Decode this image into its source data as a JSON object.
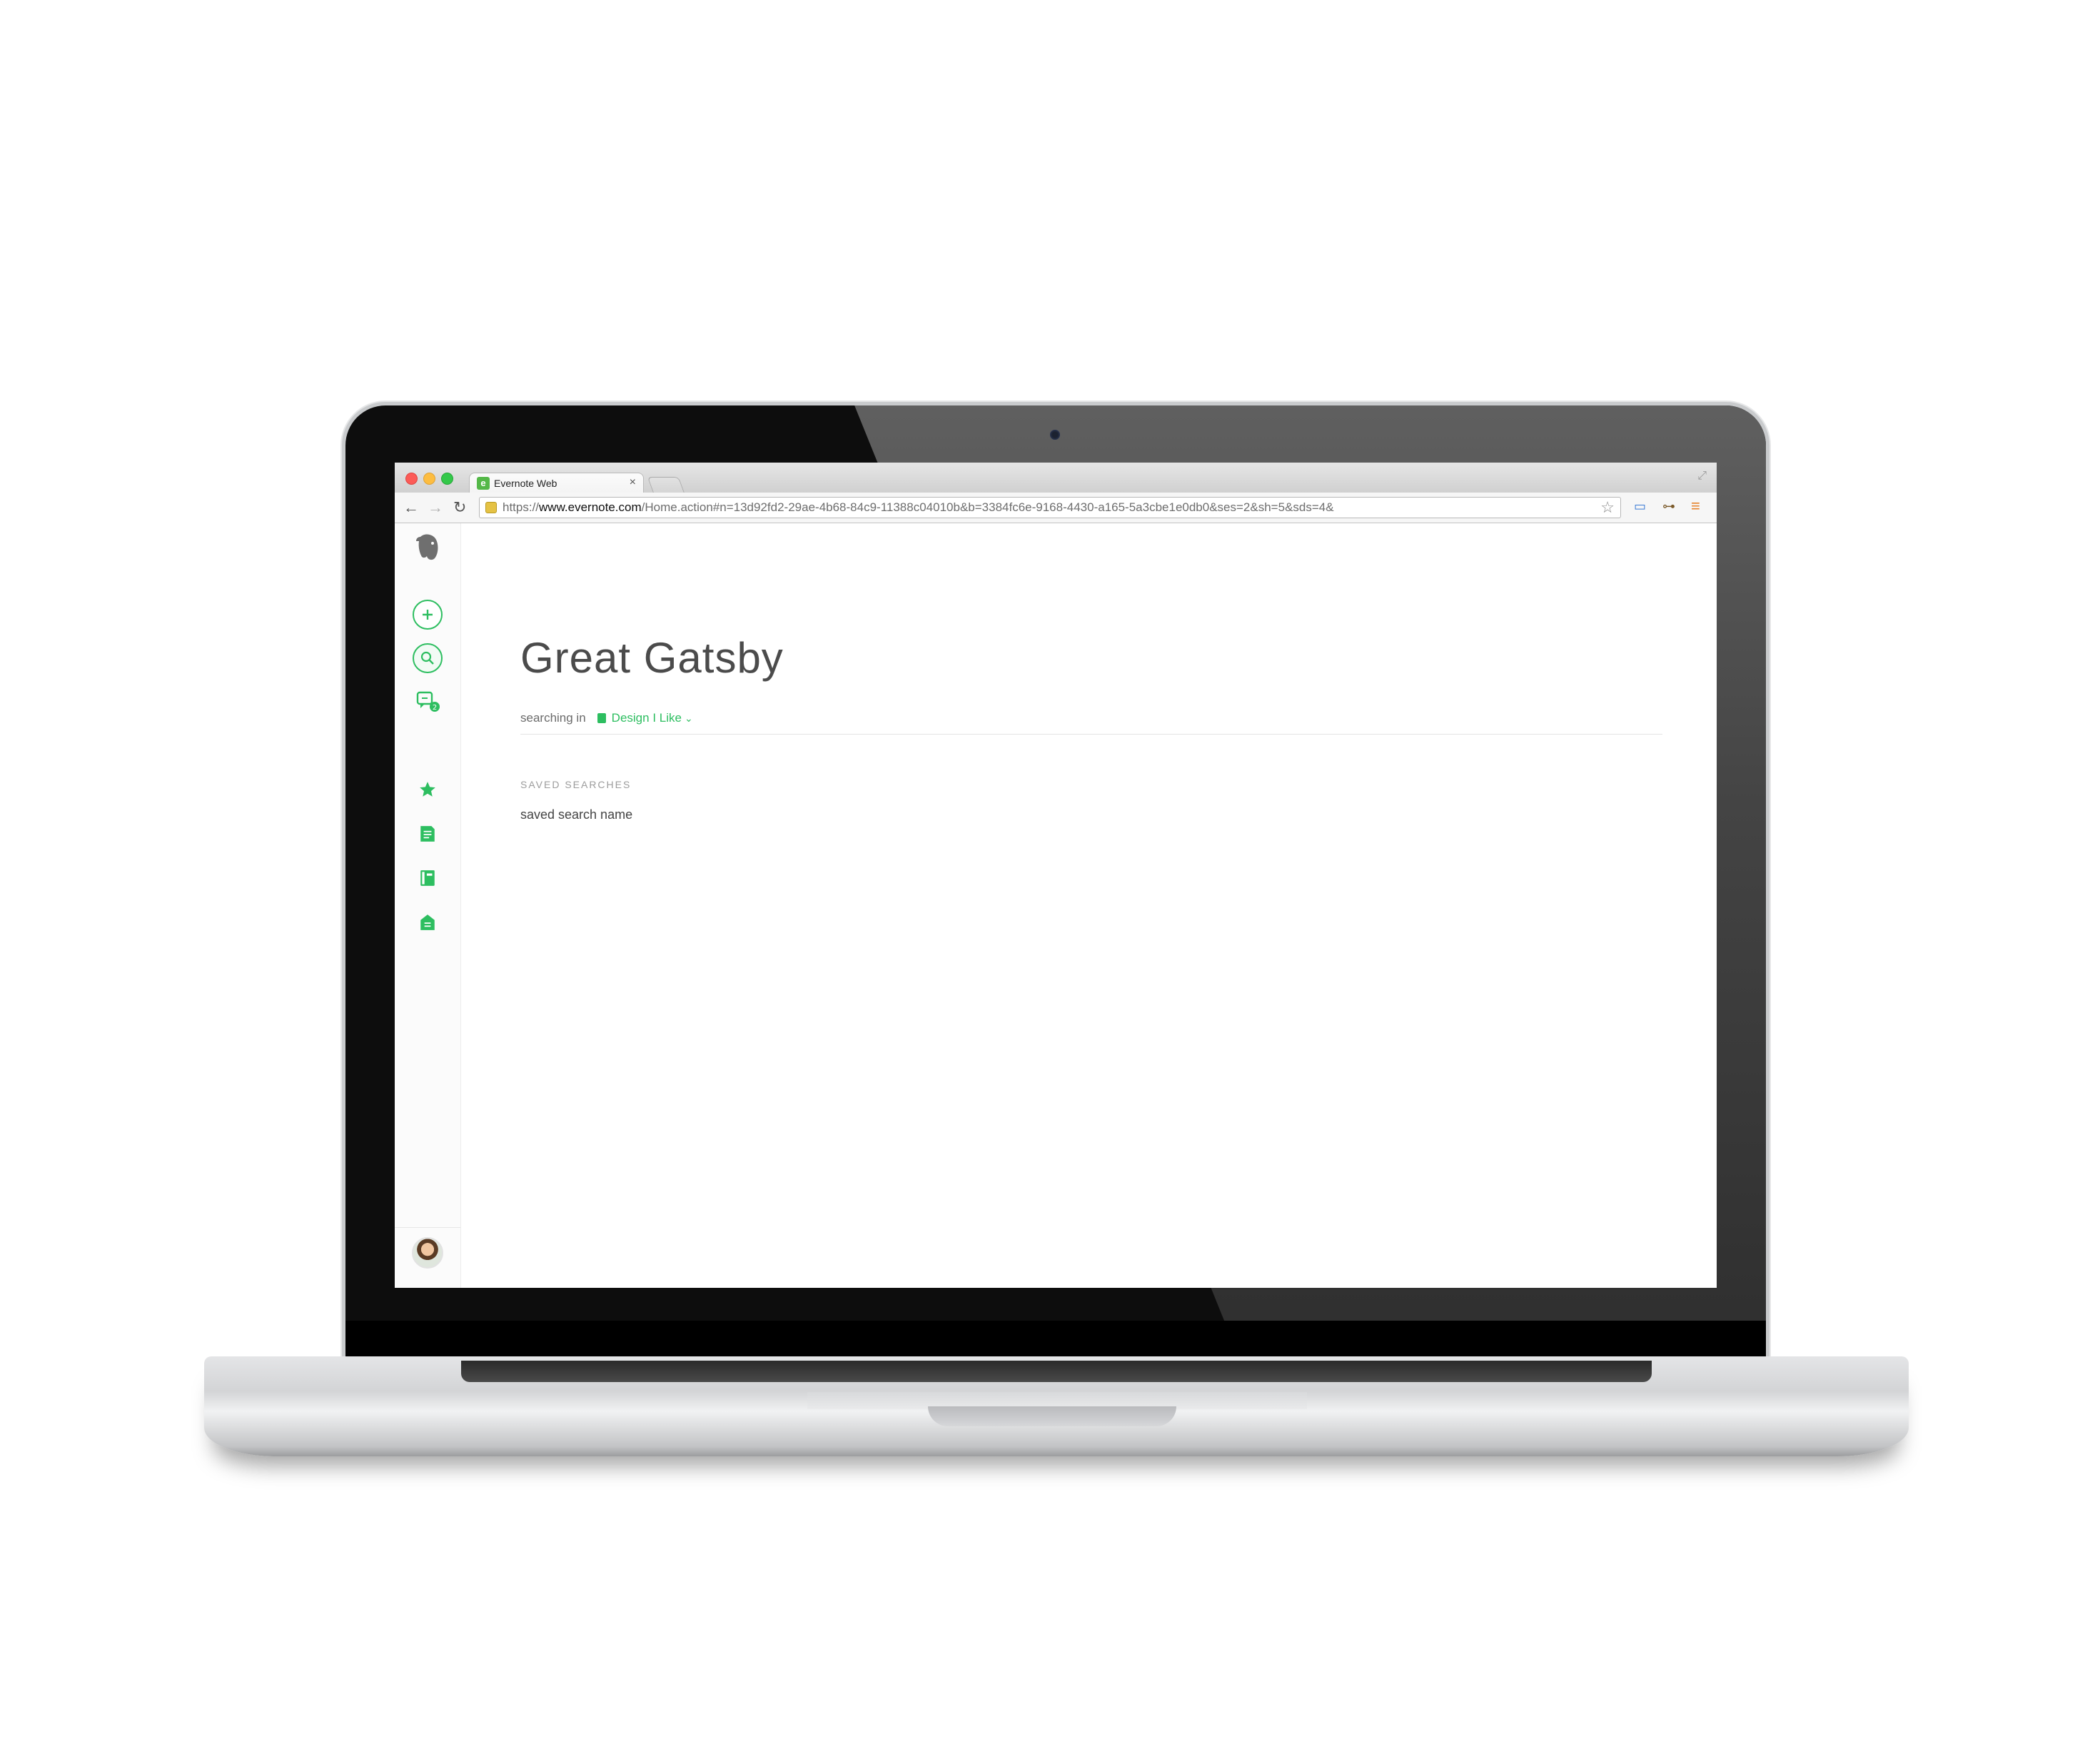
{
  "browser": {
    "tab_title": "Evernote Web",
    "tab_close": "×",
    "url_scheme": "https://",
    "url_host": "www.evernote.com",
    "url_path": "/Home.action#n=13d92fd2-29ae-4b68-84c9-11388c04010b&b=3384fc6e-9168-4430-a165-5a3cbe1e0db0&ses=2&sh=5&sds=4&"
  },
  "page": {
    "title": "Great Gatsby",
    "searching_in_label": "searching in",
    "scope_notebook": "Design I Like",
    "saved_searches_heading": "SAVED SEARCHES",
    "saved_search_items": [
      "saved search name"
    ]
  },
  "sidebar": {
    "icons": [
      "elephant-logo",
      "new-note",
      "search",
      "work-chat",
      "shortcuts",
      "notes",
      "notebooks",
      "tags",
      "account"
    ]
  },
  "colors": {
    "accent": "#2dbe60",
    "title": "#4b4b4b"
  }
}
